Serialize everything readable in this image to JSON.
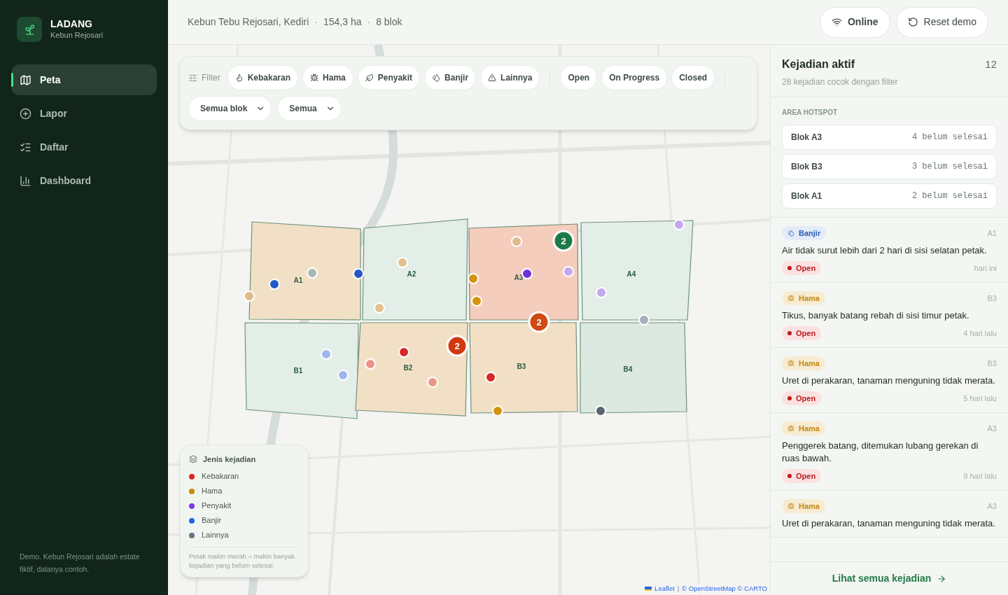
{
  "brand": {
    "name": "LADANG",
    "subtitle": "Kebun Rejosari"
  },
  "nav": [
    {
      "kind": "map",
      "label": "Peta",
      "selected": true
    },
    {
      "kind": "add",
      "label": "Lapor",
      "selected": false
    },
    {
      "kind": "list",
      "label": "Daftar",
      "selected": false
    },
    {
      "kind": "chart",
      "label": "Dashboard",
      "selected": false
    }
  ],
  "sidebar_note": "Demo. Kebun Rejosari adalah estate fiktif, datanya contoh.",
  "header": {
    "location": "Kebun Tebu Rejosari, Kediri",
    "area": "154,3 ha",
    "blocks": "8 blok",
    "separator": "·",
    "online": "Online",
    "reset": "Reset demo"
  },
  "filter": {
    "label": "Filter",
    "types": [
      {
        "kind": "kebakaran",
        "label": "Kebakaran"
      },
      {
        "kind": "hama",
        "label": "Hama"
      },
      {
        "kind": "penyakit",
        "label": "Penyakit"
      },
      {
        "kind": "banjir",
        "label": "Banjir"
      },
      {
        "kind": "lainnya",
        "label": "Lainnya"
      }
    ],
    "statuses": [
      "Open",
      "On Progress",
      "Closed"
    ],
    "selects": [
      {
        "value": "Semua blok"
      },
      {
        "value": "Semua"
      }
    ]
  },
  "map": {
    "blocks": [
      {
        "label": "A1",
        "color": "#f2e0c6"
      },
      {
        "label": "A2",
        "color": "#e4eee8"
      },
      {
        "label": "A3",
        "color": "#f5cdbd"
      },
      {
        "label": "A4",
        "color": "#e4eee8"
      },
      {
        "label": "B1",
        "color": "#e4eee8"
      },
      {
        "label": "B2",
        "color": "#f2e0c6"
      },
      {
        "label": "B3",
        "color": "#f2e0c6"
      },
      {
        "label": "B4",
        "color": "#dce9e0"
      }
    ],
    "markers": [
      {
        "color": "#2457c5"
      },
      {
        "color": "#a9b8b0"
      },
      {
        "color": "#2457c5"
      },
      {
        "color": "#e0b98f"
      },
      {
        "color": "#e2c08f"
      },
      {
        "color": "#e2c08f"
      },
      {
        "color": "#e2b98a"
      },
      {
        "color": "#d4930f"
      },
      {
        "color": "#d4930f"
      },
      {
        "color": "#6d32d6"
      },
      {
        "color": "#c4a7ee"
      },
      {
        "color": "#c4a7ee"
      },
      {
        "color": "#c4a7ee"
      },
      {
        "color": "#a7b0b8"
      },
      {
        "color": "#9fb6ea"
      },
      {
        "color": "#9fb6ea"
      },
      {
        "color": "#d92626"
      },
      {
        "color": "#e9958a"
      },
      {
        "color": "#e9958a"
      },
      {
        "color": "#d92626"
      },
      {
        "color": "#d4930f"
      },
      {
        "color": "#5b6472"
      }
    ],
    "clusters": [
      {
        "count": "2",
        "color": "#1f7a4a"
      },
      {
        "count": "2",
        "color": "#d04a12"
      },
      {
        "count": "2",
        "color": "#d2380f"
      }
    ],
    "legend": {
      "title": "Jenis kejadian",
      "items": [
        {
          "label": "Kebakaran",
          "color": "#dc2626"
        },
        {
          "label": "Hama",
          "color": "#ca8a04"
        },
        {
          "label": "Penyakit",
          "color": "#7c3aed"
        },
        {
          "label": "Banjir",
          "color": "#2563eb"
        },
        {
          "label": "Lainnya",
          "color": "#64748b"
        }
      ],
      "note": "Petak makin merah = makin banyak kejadian yang belum selesai."
    },
    "attribution": {
      "leaflet": "Leaflet",
      "separator": "|",
      "credits": "© OpenStreetMap © CARTO"
    }
  },
  "panel": {
    "title": "Kejadian aktif",
    "count": "12",
    "subtitle": "28 kejadian cocok dengan filter",
    "hotspot_title": "AREA HOTSPOT",
    "hotspots": [
      {
        "block": "Blok A3",
        "open": "4 belum selesai"
      },
      {
        "block": "Blok B3",
        "open": "3 belum selesai"
      },
      {
        "block": "Blok A1",
        "open": "2 belum selesai"
      }
    ],
    "incidents": [
      {
        "kind": "banjir",
        "type": "Banjir",
        "block": "A1",
        "text": "Air tidak surut lebih dari 2 hari di sisi selatan petak.",
        "status": "Open",
        "time": "hari ini"
      },
      {
        "kind": "hama",
        "type": "Hama",
        "block": "B3",
        "text": "Tikus, banyak batang rebah di sisi timur petak.",
        "status": "Open",
        "time": "4 hari lalu"
      },
      {
        "kind": "hama",
        "type": "Hama",
        "block": "B3",
        "text": "Uret di perakaran, tanaman menguning tidak merata.",
        "status": "Open",
        "time": "5 hari lalu"
      },
      {
        "kind": "hama",
        "type": "Hama",
        "block": "A3",
        "text": "Penggerek batang, ditemukan lubang gerekan di ruas bawah.",
        "status": "Open",
        "time": "9 hari lalu"
      },
      {
        "kind": "hama",
        "type": "Hama",
        "block": "A3",
        "text": "Uret di perakaran, tanaman menguning tidak merata."
      }
    ],
    "link": "Lihat semua kejadian"
  }
}
